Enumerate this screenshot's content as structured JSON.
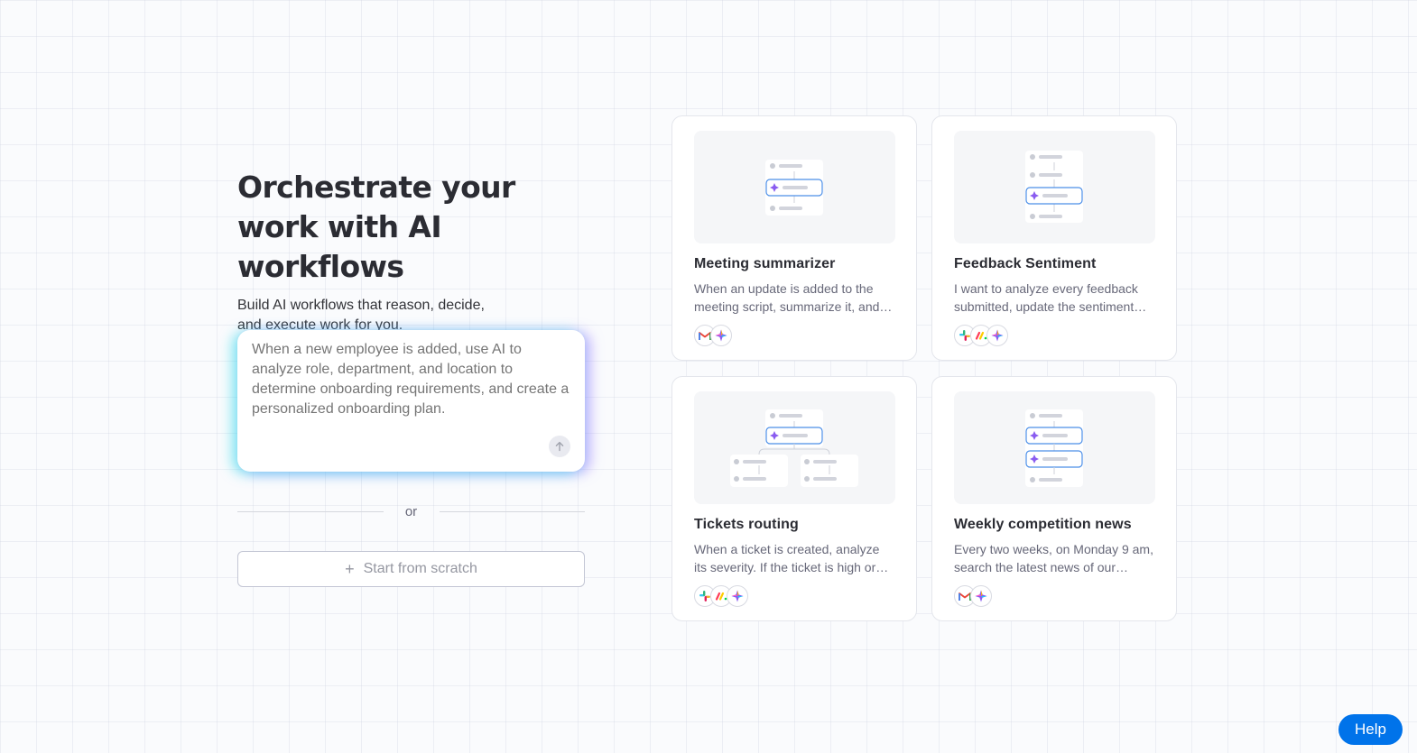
{
  "hero": {
    "title_line1": "Orchestrate your",
    "title_line2": "work with AI workflows",
    "subtitle_line1": "Build AI workflows that reason, decide,",
    "subtitle_line2": "and execute work for you."
  },
  "prompt": {
    "placeholder": "When a new employee is added, use AI to analyze role, department, and location to determine onboarding requirements, and create a personalized onboarding plan.",
    "send_icon": "arrow-up-icon"
  },
  "divider": {
    "text": "or"
  },
  "scratch": {
    "label": "Start from scratch",
    "icon": "plus-icon"
  },
  "templates": [
    {
      "title": "Meeting summarizer",
      "description": "When an update is added to the meeting script, summarize it, and…",
      "apps": [
        "gmail",
        "ai"
      ]
    },
    {
      "title": "Feedback Sentiment",
      "description": "I want to analyze every feedback submitted, update the sentiment…",
      "apps": [
        "slack",
        "monday",
        "ai"
      ]
    },
    {
      "title": "Tickets routing",
      "description": "When a ticket is created, analyze its severity. If the ticket is high or…",
      "apps": [
        "slack",
        "monday",
        "ai"
      ]
    },
    {
      "title": "Weekly competition news",
      "description": "Every two weeks, on Monday 9 am, search the latest news of our…",
      "apps": [
        "gmail",
        "ai"
      ]
    }
  ],
  "help": {
    "label": "Help"
  },
  "colors": {
    "accent": "#0073ea",
    "ai_box_glow_left": "#28dceb",
    "ai_box_glow_right": "#9678ff"
  }
}
